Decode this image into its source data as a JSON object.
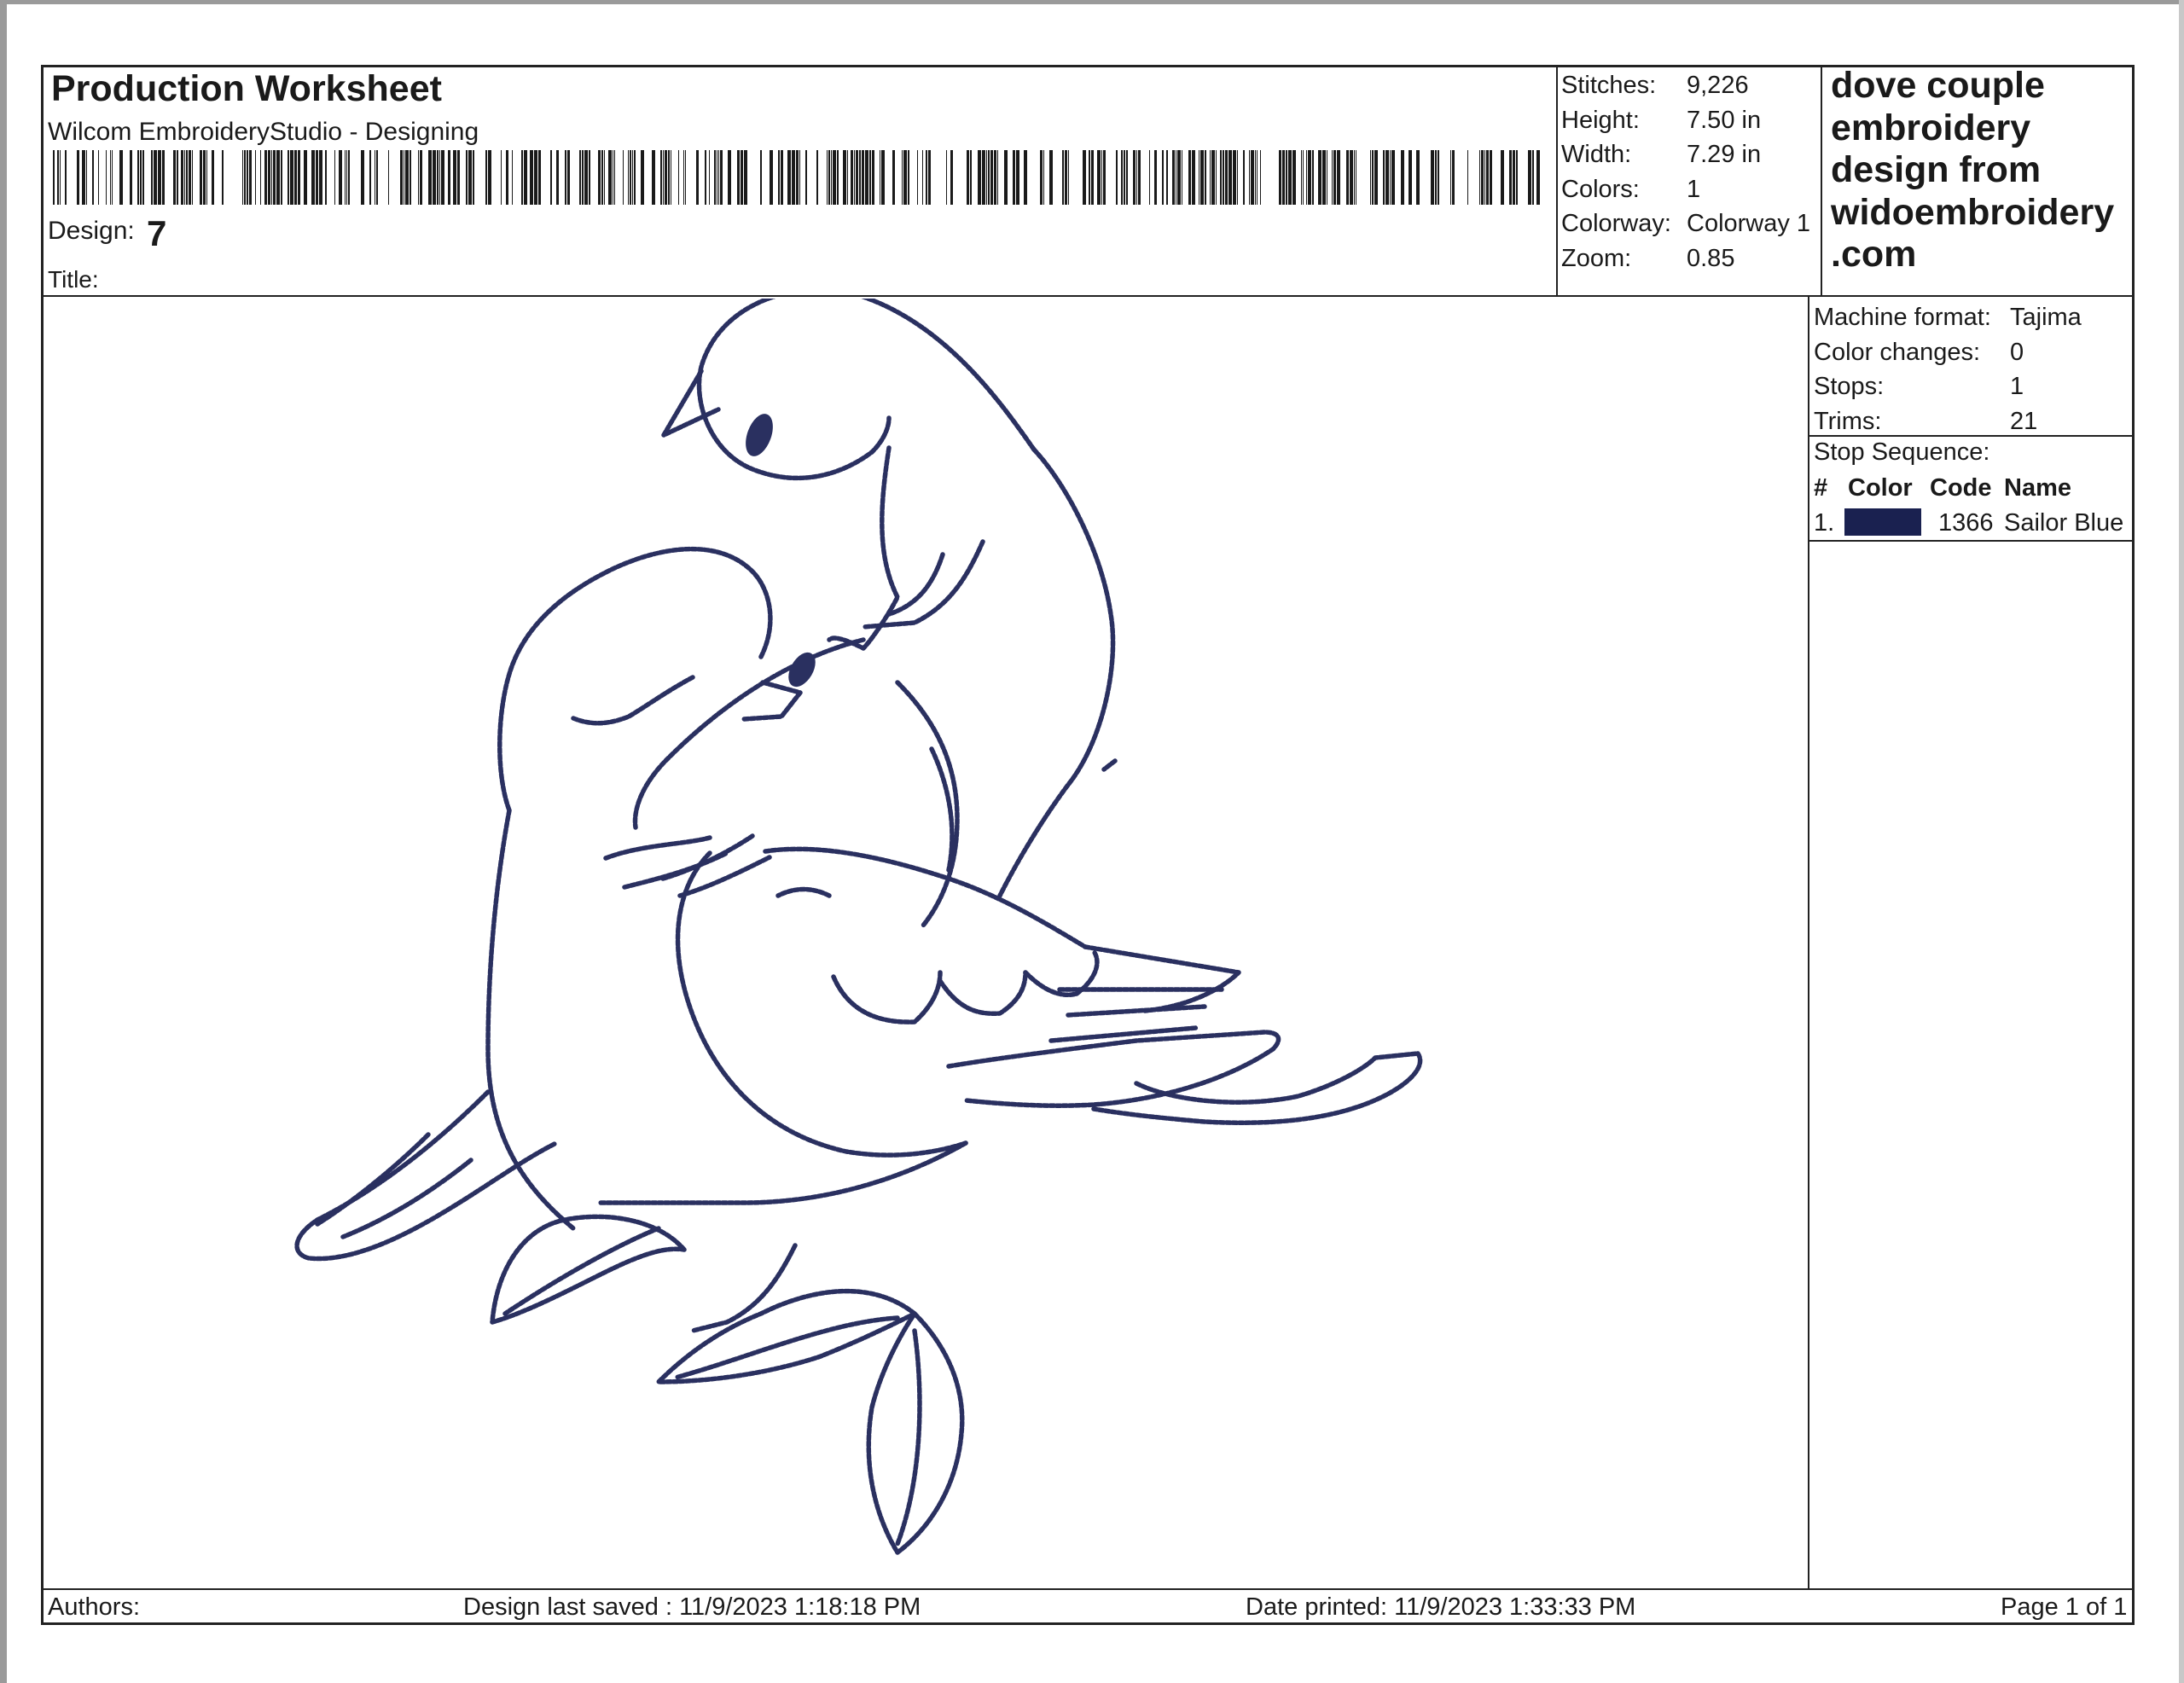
{
  "header": {
    "title": "Production Worksheet",
    "subtitle": "Wilcom EmbroideryStudio - Designing",
    "design_label": "Design:",
    "design_value": "7",
    "title_label": "Title:"
  },
  "stats": [
    {
      "label": "Stitches:",
      "value": "9,226"
    },
    {
      "label": "Height:",
      "value": "7.50 in"
    },
    {
      "label": "Width:",
      "value": "7.29 in"
    },
    {
      "label": "Colors:",
      "value": "1"
    },
    {
      "label": "Colorway:",
      "value": "Colorway 1"
    },
    {
      "label": "Zoom:",
      "value": "0.85"
    }
  ],
  "description": [
    "dove couple",
    "embroidery",
    "design from",
    "widoembroidery",
    ".com"
  ],
  "machine": [
    {
      "label": "Machine format:",
      "value": "Tajima"
    },
    {
      "label": "Color changes:",
      "value": "0"
    },
    {
      "label": "Stops:",
      "value": "1"
    },
    {
      "label": "Trims:",
      "value": "21"
    }
  ],
  "stop_sequence": {
    "label": "Stop Sequence:",
    "headers": [
      "#",
      "Color",
      "Code",
      "Name"
    ],
    "rows": [
      {
        "num": "1.",
        "color": "#1a2150",
        "code": "1366",
        "name": "Sailor Blue"
      }
    ]
  },
  "footer": {
    "authors": "Authors:",
    "saved": "Design last saved : 11/9/2023 1:18:18 PM",
    "printed": "Date printed: 11/9/2023 1:33:33 PM",
    "page": "Page 1 of 1"
  },
  "colors": {
    "thread": "#2a3060",
    "border": "#222222"
  }
}
